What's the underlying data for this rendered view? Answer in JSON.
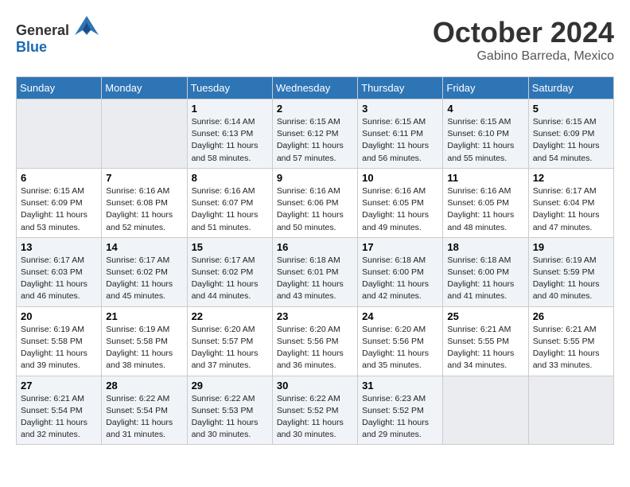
{
  "header": {
    "logo_general": "General",
    "logo_blue": "Blue",
    "month": "October 2024",
    "location": "Gabino Barreda, Mexico"
  },
  "weekdays": [
    "Sunday",
    "Monday",
    "Tuesday",
    "Wednesday",
    "Thursday",
    "Friday",
    "Saturday"
  ],
  "weeks": [
    [
      {
        "day": "",
        "empty": true
      },
      {
        "day": "",
        "empty": true
      },
      {
        "day": "1",
        "sunrise": "6:14 AM",
        "sunset": "6:13 PM",
        "daylight": "11 hours and 58 minutes."
      },
      {
        "day": "2",
        "sunrise": "6:15 AM",
        "sunset": "6:12 PM",
        "daylight": "11 hours and 57 minutes."
      },
      {
        "day": "3",
        "sunrise": "6:15 AM",
        "sunset": "6:11 PM",
        "daylight": "11 hours and 56 minutes."
      },
      {
        "day": "4",
        "sunrise": "6:15 AM",
        "sunset": "6:10 PM",
        "daylight": "11 hours and 55 minutes."
      },
      {
        "day": "5",
        "sunrise": "6:15 AM",
        "sunset": "6:09 PM",
        "daylight": "11 hours and 54 minutes."
      }
    ],
    [
      {
        "day": "6",
        "sunrise": "6:15 AM",
        "sunset": "6:09 PM",
        "daylight": "11 hours and 53 minutes."
      },
      {
        "day": "7",
        "sunrise": "6:16 AM",
        "sunset": "6:08 PM",
        "daylight": "11 hours and 52 minutes."
      },
      {
        "day": "8",
        "sunrise": "6:16 AM",
        "sunset": "6:07 PM",
        "daylight": "11 hours and 51 minutes."
      },
      {
        "day": "9",
        "sunrise": "6:16 AM",
        "sunset": "6:06 PM",
        "daylight": "11 hours and 50 minutes."
      },
      {
        "day": "10",
        "sunrise": "6:16 AM",
        "sunset": "6:05 PM",
        "daylight": "11 hours and 49 minutes."
      },
      {
        "day": "11",
        "sunrise": "6:16 AM",
        "sunset": "6:05 PM",
        "daylight": "11 hours and 48 minutes."
      },
      {
        "day": "12",
        "sunrise": "6:17 AM",
        "sunset": "6:04 PM",
        "daylight": "11 hours and 47 minutes."
      }
    ],
    [
      {
        "day": "13",
        "sunrise": "6:17 AM",
        "sunset": "6:03 PM",
        "daylight": "11 hours and 46 minutes."
      },
      {
        "day": "14",
        "sunrise": "6:17 AM",
        "sunset": "6:02 PM",
        "daylight": "11 hours and 45 minutes."
      },
      {
        "day": "15",
        "sunrise": "6:17 AM",
        "sunset": "6:02 PM",
        "daylight": "11 hours and 44 minutes."
      },
      {
        "day": "16",
        "sunrise": "6:18 AM",
        "sunset": "6:01 PM",
        "daylight": "11 hours and 43 minutes."
      },
      {
        "day": "17",
        "sunrise": "6:18 AM",
        "sunset": "6:00 PM",
        "daylight": "11 hours and 42 minutes."
      },
      {
        "day": "18",
        "sunrise": "6:18 AM",
        "sunset": "6:00 PM",
        "daylight": "11 hours and 41 minutes."
      },
      {
        "day": "19",
        "sunrise": "6:19 AM",
        "sunset": "5:59 PM",
        "daylight": "11 hours and 40 minutes."
      }
    ],
    [
      {
        "day": "20",
        "sunrise": "6:19 AM",
        "sunset": "5:58 PM",
        "daylight": "11 hours and 39 minutes."
      },
      {
        "day": "21",
        "sunrise": "6:19 AM",
        "sunset": "5:58 PM",
        "daylight": "11 hours and 38 minutes."
      },
      {
        "day": "22",
        "sunrise": "6:20 AM",
        "sunset": "5:57 PM",
        "daylight": "11 hours and 37 minutes."
      },
      {
        "day": "23",
        "sunrise": "6:20 AM",
        "sunset": "5:56 PM",
        "daylight": "11 hours and 36 minutes."
      },
      {
        "day": "24",
        "sunrise": "6:20 AM",
        "sunset": "5:56 PM",
        "daylight": "11 hours and 35 minutes."
      },
      {
        "day": "25",
        "sunrise": "6:21 AM",
        "sunset": "5:55 PM",
        "daylight": "11 hours and 34 minutes."
      },
      {
        "day": "26",
        "sunrise": "6:21 AM",
        "sunset": "5:55 PM",
        "daylight": "11 hours and 33 minutes."
      }
    ],
    [
      {
        "day": "27",
        "sunrise": "6:21 AM",
        "sunset": "5:54 PM",
        "daylight": "11 hours and 32 minutes."
      },
      {
        "day": "28",
        "sunrise": "6:22 AM",
        "sunset": "5:54 PM",
        "daylight": "11 hours and 31 minutes."
      },
      {
        "day": "29",
        "sunrise": "6:22 AM",
        "sunset": "5:53 PM",
        "daylight": "11 hours and 30 minutes."
      },
      {
        "day": "30",
        "sunrise": "6:22 AM",
        "sunset": "5:52 PM",
        "daylight": "11 hours and 30 minutes."
      },
      {
        "day": "31",
        "sunrise": "6:23 AM",
        "sunset": "5:52 PM",
        "daylight": "11 hours and 29 minutes."
      },
      {
        "day": "",
        "empty": true
      },
      {
        "day": "",
        "empty": true
      }
    ]
  ]
}
